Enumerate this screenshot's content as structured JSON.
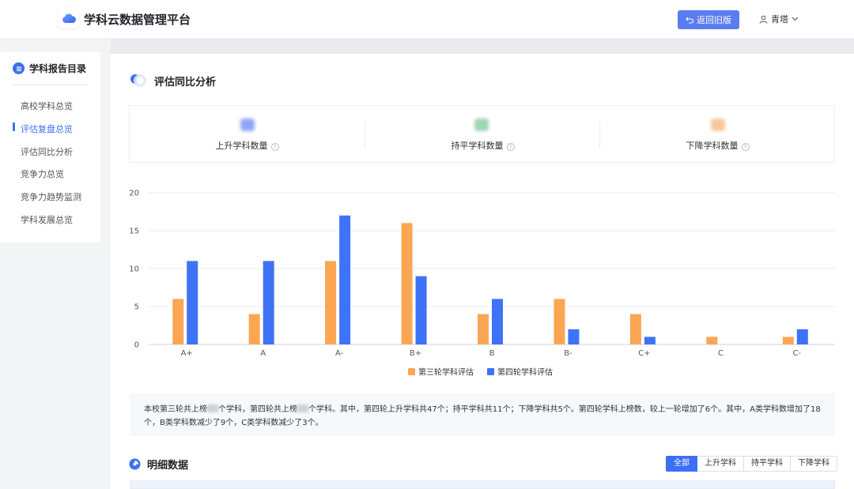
{
  "header": {
    "app_title": "学科云数据管理平台",
    "back_button": "返回旧版",
    "user_name": "青塔",
    "logo_icon": "cloud-icon"
  },
  "sidebar": {
    "title": "学科报告目录",
    "items": [
      {
        "label": "高校学科总览",
        "active": false
      },
      {
        "label": "评估复盘总览",
        "active": true
      },
      {
        "label": "评估同比分析",
        "active": false
      },
      {
        "label": "竞争力总览",
        "active": false
      },
      {
        "label": "竞争力趋势监测",
        "active": false
      },
      {
        "label": "学科发展总览",
        "active": false
      }
    ]
  },
  "section1": {
    "title": "评估同比分析",
    "stats": [
      {
        "label": "上升学科数量",
        "color": "#8fa6f6"
      },
      {
        "label": "持平学科数量",
        "color": "#9fd6b4"
      },
      {
        "label": "下降学科数量",
        "color": "#f6c79a"
      }
    ]
  },
  "chart_data": {
    "type": "bar",
    "categories": [
      "A+",
      "A",
      "A-",
      "B+",
      "B",
      "B-",
      "C+",
      "C",
      "C-"
    ],
    "series": [
      {
        "name": "第三轮学科评估",
        "color": "#fba653",
        "values": [
          6,
          4,
          11,
          16,
          4,
          6,
          4,
          1,
          1
        ]
      },
      {
        "name": "第四轮学科评估",
        "color": "#3e72f7",
        "values": [
          11,
          11,
          17,
          9,
          6,
          2,
          1,
          0,
          2
        ]
      }
    ],
    "ylim": [
      0,
      20
    ],
    "yticks": [
      0,
      5,
      10,
      15,
      20
    ],
    "grid": true,
    "legend_position": "bottom"
  },
  "summary": {
    "p1": "本校第三轮共上榜",
    "p2": "个学科，第四轮共上榜",
    "p3": "个学科。其中，第四轮上升学科共47个；持平学科共11个；下降学科共5个。第四轮学科上榜数，较上一轮增加了6个。其中，A类学科数增加了18个，B类学科数减少了9个，C类学科数减少了3个。"
  },
  "section2": {
    "title": "明细数据",
    "tabs": [
      {
        "label": "全部",
        "active": true
      },
      {
        "label": "上升学科",
        "active": false
      },
      {
        "label": "持平学科",
        "active": false
      },
      {
        "label": "下降学科",
        "active": false
      }
    ]
  }
}
